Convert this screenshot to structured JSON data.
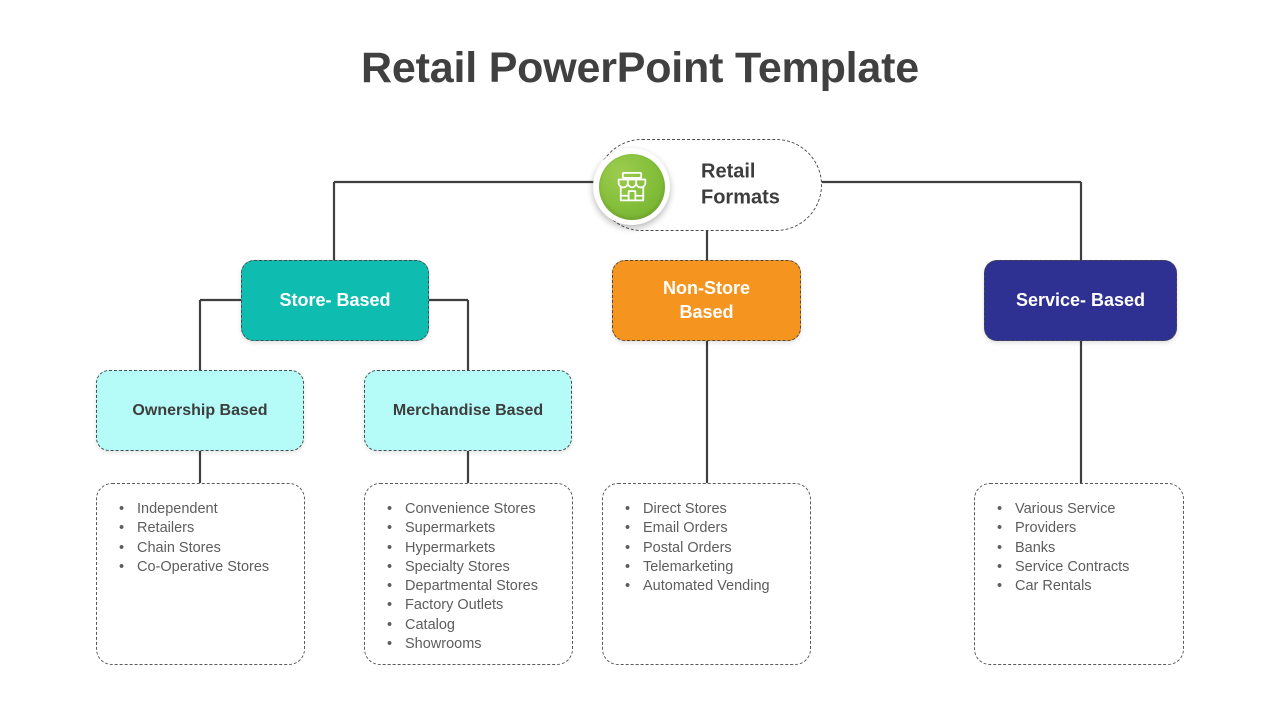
{
  "title": "Retail PowerPoint Template",
  "colors": {
    "title_text": "#404040",
    "store_based": "#0EBDB0",
    "non_store_based": "#F5951F",
    "service_based": "#2E3192",
    "sub_box": "#B5FCF8",
    "root_icon_green": "#86C03C",
    "connector_line": "#3F3F3F",
    "body_text": "#5D5D5D",
    "background": "#FFFFFF"
  },
  "root": {
    "label": "Retail\nFormats",
    "label_line1": "Retail",
    "label_line2": "Formats",
    "icon": "storefront-icon"
  },
  "categories": [
    {
      "id": "store-based",
      "label": "Store-  Based",
      "color": "#0EBDB0"
    },
    {
      "id": "non-store-based",
      "label_line1": "Non-Store",
      "label_line2": "Based",
      "color": "#F5951F"
    },
    {
      "id": "service-based",
      "label": "Service-  Based",
      "color": "#2E3192"
    }
  ],
  "subcategories": [
    {
      "id": "ownership-based",
      "label": "Ownership Based"
    },
    {
      "id": "merchandise-based",
      "label": "Merchandise Based"
    }
  ],
  "lists": {
    "ownership": [
      "Independent",
      "Retailers",
      "Chain Stores",
      "Co-Operative Stores"
    ],
    "merchandise": [
      "Convenience Stores",
      "Supermarkets",
      "Hypermarkets",
      "Specialty Stores",
      "Departmental  Stores",
      "Factory Outlets",
      "Catalog",
      "Showrooms"
    ],
    "nonstore": [
      "Direct Stores",
      "Email Orders",
      "Postal Orders",
      "Telemarketing",
      "Automated  Vending"
    ],
    "service": [
      "Various Service",
      "Providers",
      "Banks",
      "Service Contracts",
      "Car Rentals"
    ]
  },
  "bullet_glyph": "•"
}
